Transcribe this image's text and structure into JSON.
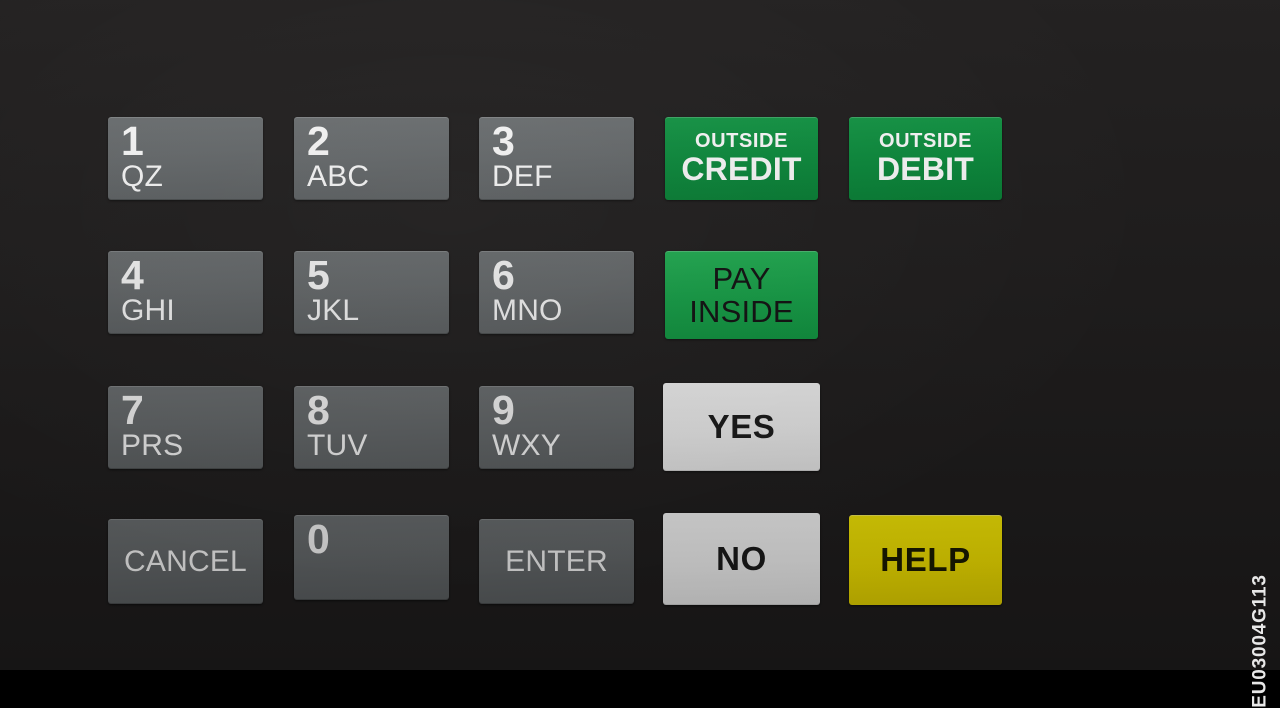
{
  "overlay": {
    "background_color": "#201e1e",
    "part_number": "EU03004G113"
  },
  "colors": {
    "key_gray": "#666a6c",
    "green_dark": "#0a8c3c",
    "green_bright": "#16a74a",
    "white": "#fdfdfd",
    "yellow": "#fae800",
    "text_light": "#ffffff",
    "text_dark": "#1b1b1b"
  },
  "keys": {
    "k1": {
      "digit": "1",
      "letters": "QZ"
    },
    "k2": {
      "digit": "2",
      "letters": "ABC"
    },
    "k3": {
      "digit": "3",
      "letters": "DEF"
    },
    "k4": {
      "digit": "4",
      "letters": "GHI"
    },
    "k5": {
      "digit": "5",
      "letters": "JKL"
    },
    "k6": {
      "digit": "6",
      "letters": "MNO"
    },
    "k7": {
      "digit": "7",
      "letters": "PRS"
    },
    "k8": {
      "digit": "8",
      "letters": "TUV"
    },
    "k9": {
      "digit": "9",
      "letters": "WXY"
    },
    "k0": {
      "digit": "0",
      "letters": ""
    },
    "cancel": {
      "label": "CANCEL"
    },
    "enter": {
      "label": "ENTER"
    }
  },
  "function_keys": {
    "outside_credit": {
      "line1": "OUTSIDE",
      "line2": "CREDIT"
    },
    "outside_debit": {
      "line1": "OUTSIDE",
      "line2": "DEBIT"
    },
    "pay_inside": {
      "line1": "PAY",
      "line2": "INSIDE"
    },
    "yes": {
      "label": "YES"
    },
    "no": {
      "label": "NO"
    },
    "help": {
      "label": "HELP"
    }
  }
}
